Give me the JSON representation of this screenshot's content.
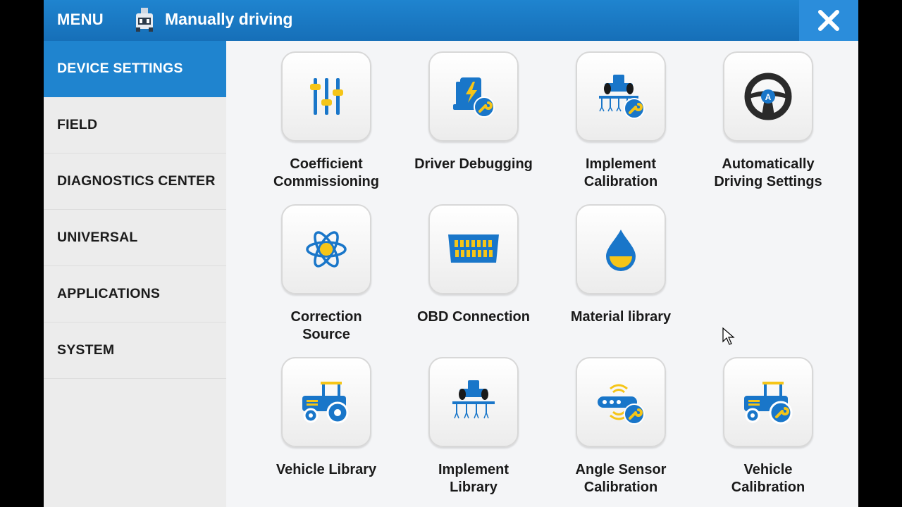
{
  "header": {
    "menu_label": "MENU",
    "mode_label": "Manually driving",
    "mode_icon": "tractor-mode-icon",
    "close_icon": "close-icon"
  },
  "sidebar": {
    "items": [
      {
        "label": "DEVICE SETTINGS",
        "active": true
      },
      {
        "label": "FIELD",
        "active": false
      },
      {
        "label": "DIAGNOSTICS CENTER",
        "active": false
      },
      {
        "label": "UNIVERSAL",
        "active": false
      },
      {
        "label": "APPLICATIONS",
        "active": false
      },
      {
        "label": "SYSTEM",
        "active": false
      }
    ]
  },
  "tiles": [
    {
      "label": "Coefficient\nCommissioning",
      "icon": "sliders-icon"
    },
    {
      "label": "Driver Debugging",
      "icon": "driver-debug-icon"
    },
    {
      "label": "Implement\nCalibration",
      "icon": "implement-calibration-icon"
    },
    {
      "label": "Automatically\nDriving Settings",
      "icon": "steering-wheel-icon"
    },
    {
      "label": "Correction\nSource",
      "icon": "atom-icon"
    },
    {
      "label": "OBD Connection",
      "icon": "obd-connector-icon"
    },
    {
      "label": "Material library",
      "icon": "drop-icon"
    },
    {
      "label": "Vehicle Library",
      "icon": "tractor-icon"
    },
    {
      "label": "Implement\nLibrary",
      "icon": "implement-icon"
    },
    {
      "label": "Angle Sensor\nCalibration",
      "icon": "angle-sensor-icon"
    },
    {
      "label": "Vehicle\nCalibration",
      "icon": "tractor-wrench-icon"
    }
  ],
  "colors": {
    "header_blue": "#1f84cf",
    "icon_blue": "#1976c9",
    "icon_yellow": "#f5c518"
  }
}
